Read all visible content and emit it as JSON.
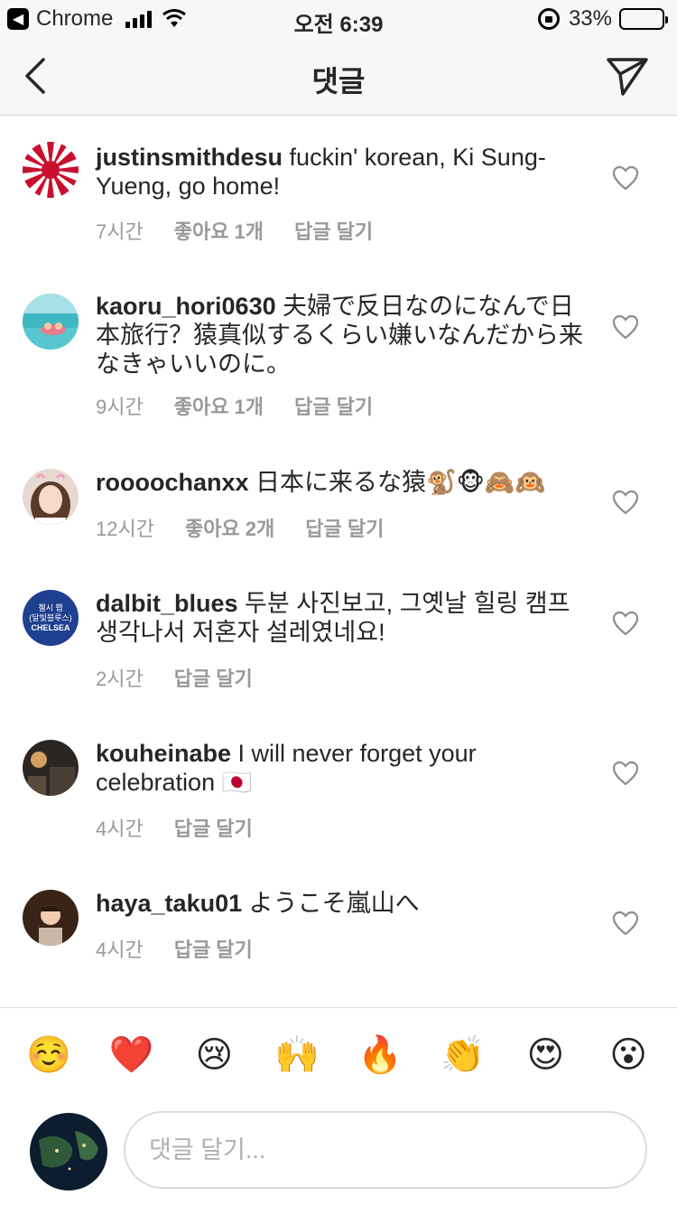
{
  "status": {
    "app": "Chrome",
    "time": "오전 6:39",
    "battery": "33%",
    "battery_level": 0.33
  },
  "nav": {
    "title": "댓글"
  },
  "comments": [
    {
      "user": "justinsmithdesu",
      "text": "fuckin' korean, Ki Sung-Yueng, go home!",
      "time": "7시간",
      "likes": "좋아요 1개",
      "reply": "답글 달기"
    },
    {
      "user": "kaoru_hori0630",
      "text": "夫婦で反日なのになんで日本旅行？猿真似するくらい嫌いなんだから来なきゃいいのに。",
      "time": "9시간",
      "likes": "좋아요 1개",
      "reply": "답글 달기"
    },
    {
      "user": "roooochanxx",
      "text": "日本に来るな猿🐒🐵🙈🙉",
      "time": "12시간",
      "likes": "좋아요 2개",
      "reply": "답글 달기"
    },
    {
      "user": "dalbit_blues",
      "text": "두분 사진보고, 그옛날 힐링 캠프 생각나서 저혼자 설레였네요!",
      "time": "2시간",
      "likes": "",
      "reply": "답글 달기"
    },
    {
      "user": "kouheinabe",
      "text": "I will never forget your celebration 🇯🇵",
      "time": "4시간",
      "likes": "",
      "reply": "답글 달기"
    },
    {
      "user": "haya_taku01",
      "text": "ようこそ嵐山へ",
      "time": "4시간",
      "likes": "",
      "reply": "답글 달기"
    }
  ],
  "avatar3_label": [
    "첼시 팹",
    "(달빛블루스)",
    "CHELSEA"
  ],
  "emojis": [
    "☺️",
    "❤️",
    "😢",
    "🙌",
    "🔥",
    "👏",
    "😍",
    "😮"
  ],
  "input": {
    "placeholder": "댓글 달기..."
  }
}
